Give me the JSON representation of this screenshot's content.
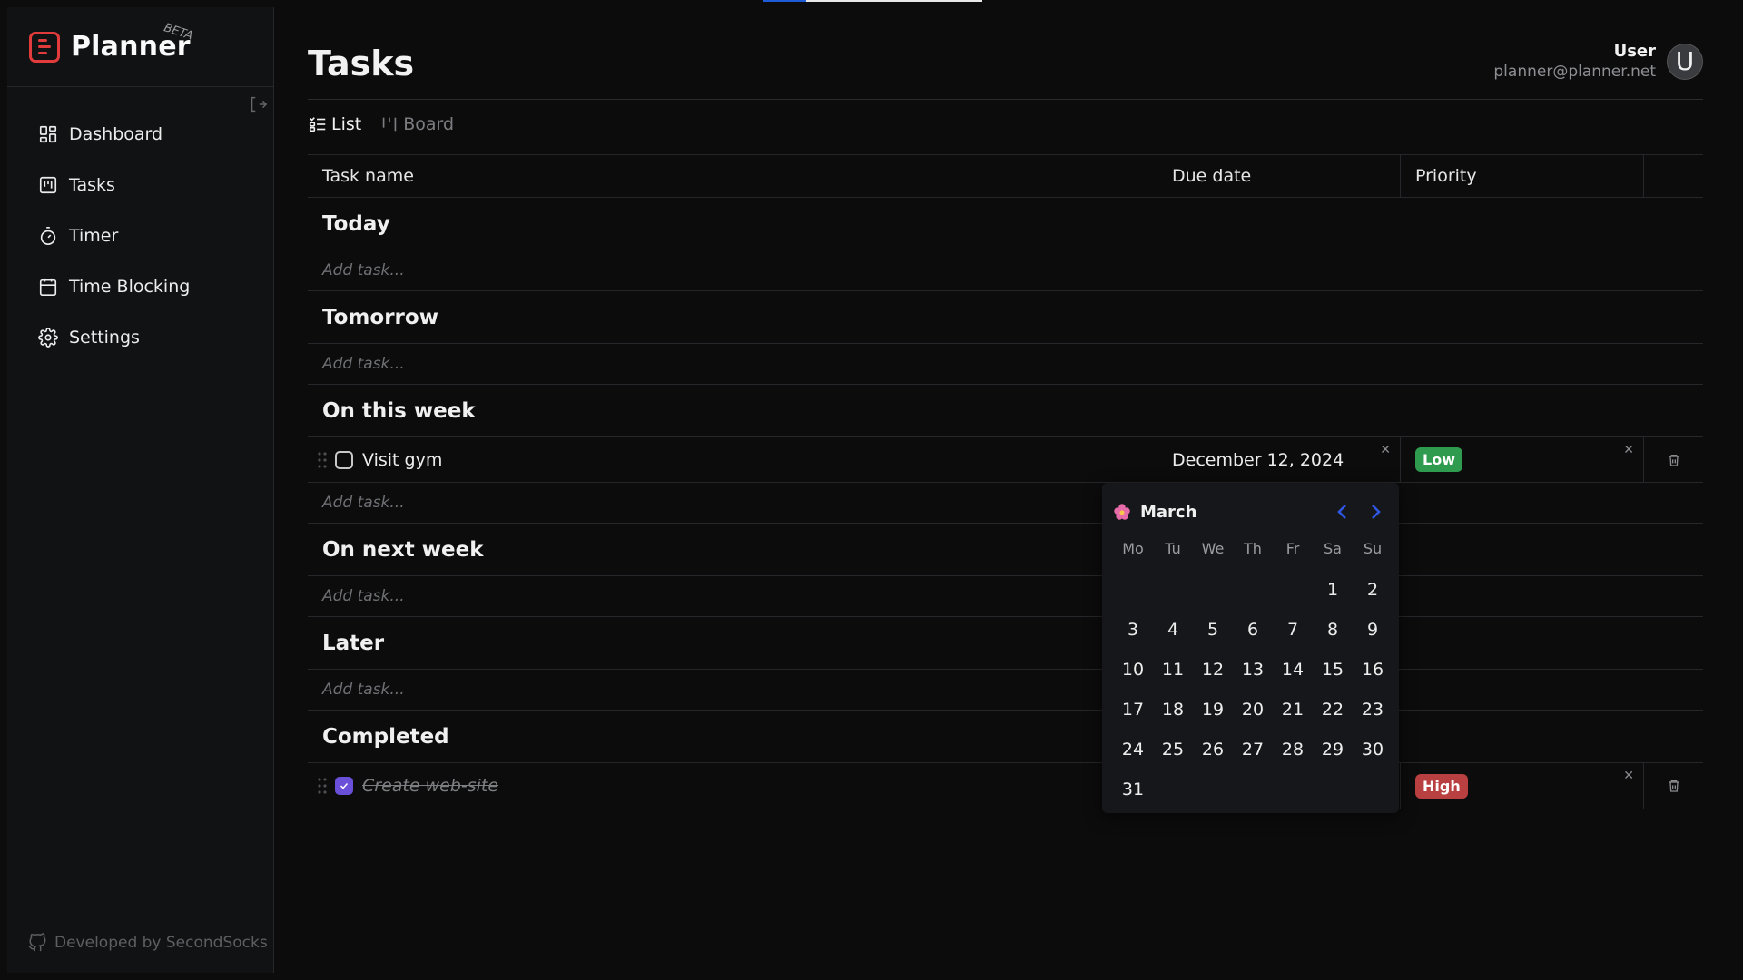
{
  "brand": {
    "name": "Planner",
    "beta": "BETA"
  },
  "sidebar": {
    "items": [
      {
        "label": "Dashboard",
        "icon": "dashboard-icon"
      },
      {
        "label": "Tasks",
        "icon": "kanban-icon"
      },
      {
        "label": "Timer",
        "icon": "timer-icon"
      },
      {
        "label": "Time Blocking",
        "icon": "calendar-icon"
      },
      {
        "label": "Settings",
        "icon": "gear-icon"
      }
    ],
    "footer": "Developed by SecondSocks"
  },
  "header": {
    "title": "Tasks",
    "user_name": "User",
    "user_email": "planner@planner.net",
    "avatar_letter": "U"
  },
  "views": {
    "list": "List",
    "board": "Board",
    "active": "List"
  },
  "table": {
    "columns": {
      "name": "Task name",
      "due": "Due date",
      "priority": "Priority"
    },
    "add_placeholder": "Add task...",
    "groups": [
      {
        "title": "Today",
        "tasks": []
      },
      {
        "title": "Tomorrow",
        "tasks": []
      },
      {
        "title": "On this week",
        "tasks": [
          {
            "name": "Visit gym",
            "due": "December 12, 2024",
            "priority": "Low",
            "done": false
          }
        ]
      },
      {
        "title": "On next week",
        "tasks": []
      },
      {
        "title": "Later",
        "tasks": []
      },
      {
        "title": "Completed",
        "tasks": [
          {
            "name": "Create web-site",
            "due": "",
            "priority": "High",
            "done": true
          }
        ]
      }
    ]
  },
  "colors": {
    "accent_brand": "#e23b3b",
    "priority_low": "#2e9b4e",
    "priority_high": "#b94040",
    "checkbox_done": "#6a4fd8",
    "calendar_nav": "#2f56e0"
  },
  "calendar": {
    "month": "March",
    "weekdays": [
      "Mo",
      "Tu",
      "We",
      "Th",
      "Fr",
      "Sa",
      "Su"
    ],
    "days": [
      "",
      "",
      "",
      "",
      "",
      "1",
      "2",
      "3",
      "4",
      "5",
      "6",
      "7",
      "8",
      "9",
      "10",
      "11",
      "12",
      "13",
      "14",
      "15",
      "16",
      "17",
      "18",
      "19",
      "20",
      "21",
      "22",
      "23",
      "24",
      "25",
      "26",
      "27",
      "28",
      "29",
      "30",
      "31"
    ]
  }
}
